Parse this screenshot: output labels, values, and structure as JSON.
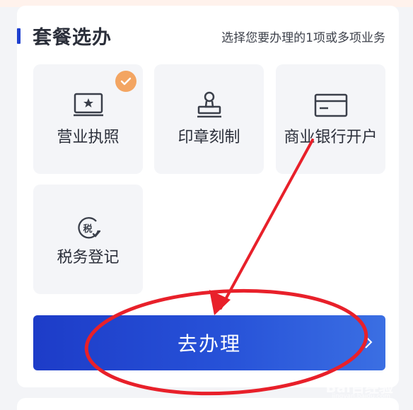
{
  "section": {
    "title": "套餐选办",
    "subtitle": "选择您要办理的1项或多项业务"
  },
  "services": [
    {
      "label": "营业执照",
      "icon": "license-icon",
      "selected": true
    },
    {
      "label": "印章刻制",
      "icon": "stamp-icon",
      "selected": false
    },
    {
      "label": "商业银行开户",
      "icon": "bank-card-icon",
      "selected": false
    },
    {
      "label": "税务登记",
      "icon": "tax-icon",
      "selected": false
    }
  ],
  "tax_icon_glyph": "税",
  "action": {
    "label": "去办理",
    "chevron": "chevron-right-icon"
  },
  "watermark": {
    "brand": "Bai百经验",
    "sub": "jingyan.baidu.com"
  },
  "colors": {
    "accent": "#1e3fcf",
    "check": "#f3a562",
    "annotation": "#e8202a"
  }
}
